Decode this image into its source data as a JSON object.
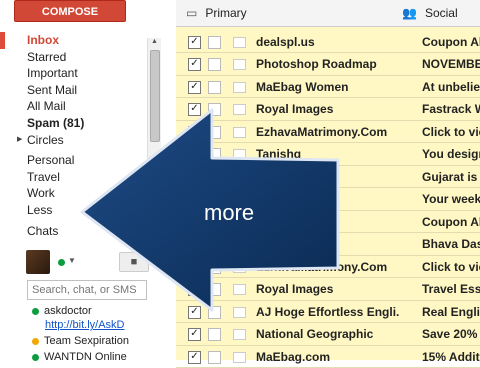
{
  "compose_label": "COMPOSE",
  "nav": {
    "items": [
      {
        "label": "Inbox"
      },
      {
        "label": "Starred"
      },
      {
        "label": "Important"
      },
      {
        "label": "Sent Mail"
      },
      {
        "label": "All Mail"
      },
      {
        "label": "Spam (81)"
      },
      {
        "label": "Circles"
      },
      {
        "label": "Personal"
      },
      {
        "label": "Travel"
      },
      {
        "label": "Work"
      },
      {
        "label": "Less"
      },
      {
        "label": "Chats"
      }
    ]
  },
  "chat": {
    "search_placeholder": "Search, chat, or SMS",
    "contacts": [
      {
        "name": "askdoctor",
        "status": "http://bit.ly/AskD",
        "color": "#0c9d3e"
      },
      {
        "name": "Team Sexpiration",
        "color": "#f2a600"
      },
      {
        "name": "WANTDN Online",
        "color": "#0c9d3e"
      }
    ]
  },
  "tabs": [
    {
      "label": "Primary"
    },
    {
      "label": "Social"
    }
  ],
  "emails": [
    {
      "sender": "dealspl.us",
      "subject": "Coupon Al"
    },
    {
      "sender": "Photoshop Roadmap",
      "subject": "NOVEMBER"
    },
    {
      "sender": "MaEbag Women",
      "subject": "At unbeliev"
    },
    {
      "sender": "Royal Images",
      "subject": "Fastrack W"
    },
    {
      "sender": "EzhavaMatrimony.Com",
      "subject": "Click to vie"
    },
    {
      "sender": "Tanishq",
      "subject": "You design"
    },
    {
      "sender": "",
      "subject": "Gujarat is"
    },
    {
      "sender": "",
      "subject": "Your week"
    },
    {
      "sender": "",
      "subject": "Coupon Al"
    },
    {
      "sender": "",
      "subject": "Bhava Das"
    },
    {
      "sender": "EzhavaMatrimony.Com",
      "subject": "Click to vie"
    },
    {
      "sender": "Royal Images",
      "subject": "Travel Esse"
    },
    {
      "sender": "AJ Hoge Effortless Engli.",
      "subject": "Real Englis"
    },
    {
      "sender": "National Geographic",
      "subject": "Save 20% O"
    },
    {
      "sender": "MaEbag.com",
      "subject": "15% Additi"
    }
  ],
  "overlay": {
    "label": "more"
  },
  "colors": {
    "compose": "#d14836",
    "mail_bg": "#fff8c4",
    "arrow": "#0d2f5c"
  }
}
